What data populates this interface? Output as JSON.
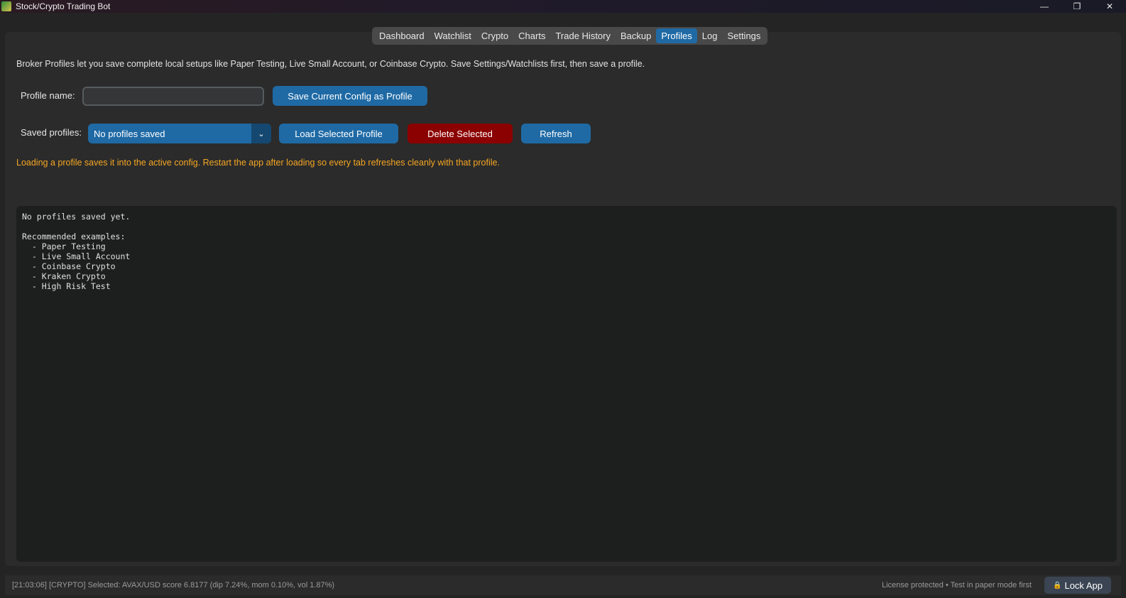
{
  "window": {
    "title": "Stock/Crypto Trading Bot",
    "minimize": "—",
    "restore": "❐",
    "close": "✕"
  },
  "tabs": [
    {
      "label": "Dashboard",
      "active": false
    },
    {
      "label": "Watchlist",
      "active": false
    },
    {
      "label": "Crypto",
      "active": false
    },
    {
      "label": "Charts",
      "active": false
    },
    {
      "label": "Trade History",
      "active": false
    },
    {
      "label": "Backup",
      "active": false
    },
    {
      "label": "Profiles",
      "active": true
    },
    {
      "label": "Log",
      "active": false
    },
    {
      "label": "Settings",
      "active": false
    }
  ],
  "profiles": {
    "description": "Broker Profiles let you save complete local setups like Paper Testing, Live Small Account, or Coinbase Crypto. Save Settings/Watchlists first, then save a profile.",
    "profile_name_label": "Profile name:",
    "profile_name_value": "",
    "save_button": "Save Current Config as Profile",
    "saved_profiles_label": "Saved profiles:",
    "saved_profiles_selected": "No profiles saved",
    "load_button": "Load Selected Profile",
    "delete_button": "Delete Selected",
    "refresh_button": "Refresh",
    "warning": "Loading a profile saves it into the active config. Restart the app after loading so every tab refreshes cleanly with that profile.",
    "output_text": "No profiles saved yet.\n\nRecommended examples:\n  - Paper Testing\n  - Live Small Account\n  - Coinbase Crypto\n  - Kraken Crypto\n  - High Risk Test"
  },
  "status": {
    "log": "[21:03:06] [CRYPTO] Selected: AVAX/USD score 6.8177 (dip 7.24%, mom 0.10%, vol 1.87%)",
    "license": "License protected • Test in paper mode first",
    "lock_button": "Lock App"
  },
  "colors": {
    "accent": "#1f6aa5",
    "danger": "#8b0000",
    "warning": "#f5a623"
  }
}
